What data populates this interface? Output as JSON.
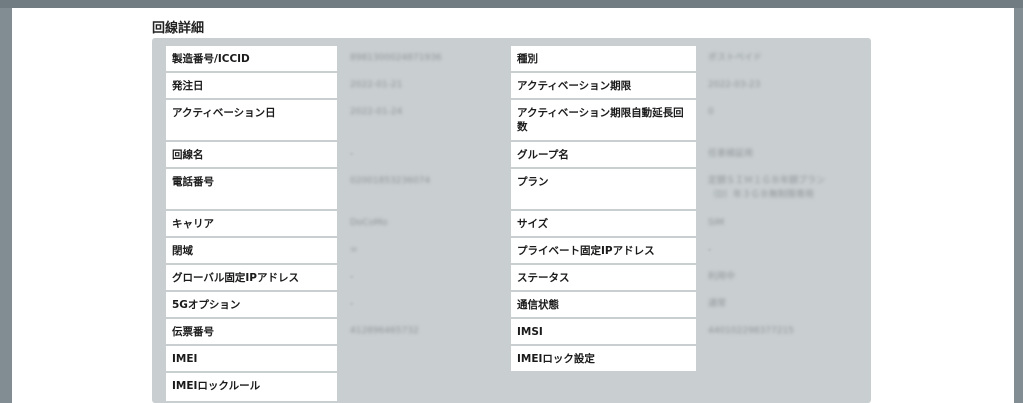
{
  "section": {
    "title": "回線詳細"
  },
  "left_rows": [
    {
      "label": "製造番号/ICCID",
      "value": "8981300024871936"
    },
    {
      "label": "発注日",
      "value": "2022-01-21"
    },
    {
      "label": "アクティベーション日",
      "value": "2022-01-24"
    },
    {
      "label": "回線名",
      "value": "-"
    },
    {
      "label": "電話番号",
      "value": "02001853236074"
    },
    {
      "label": "キャリア",
      "value": "DoCoMo"
    },
    {
      "label": "閉域",
      "value": "∞"
    },
    {
      "label": "グローバル固定IPアドレス",
      "value": "-"
    },
    {
      "label": "5Gオプション",
      "value": "-"
    },
    {
      "label": "伝票番号",
      "value": "412896465732"
    },
    {
      "label": "IMEI",
      "value": ""
    },
    {
      "label": "IMEIロックルール",
      "value": ""
    }
  ],
  "right_rows": [
    {
      "label": "種別",
      "value": "ポストペイド"
    },
    {
      "label": "アクティベーション期限",
      "value": "2022-03-23"
    },
    {
      "label": "アクティベーション期限自動延長回数",
      "value": "0"
    },
    {
      "label": "グループ名",
      "value": "任意検証用"
    },
    {
      "label": "プラン",
      "value": "定額ＳＩＭ１ＧＢ年額プラン\n（D）年３ＧＢ無制限専用"
    },
    {
      "label": "サイズ",
      "value": "SIM"
    },
    {
      "label": "プライベート固定IPアドレス",
      "value": "-"
    },
    {
      "label": "ステータス",
      "value": "利用中"
    },
    {
      "label": "通信状態",
      "value": "通常"
    },
    {
      "label": "IMSI",
      "value": "440102298377215"
    },
    {
      "label": "IMEIロック設定",
      "value": ""
    }
  ]
}
